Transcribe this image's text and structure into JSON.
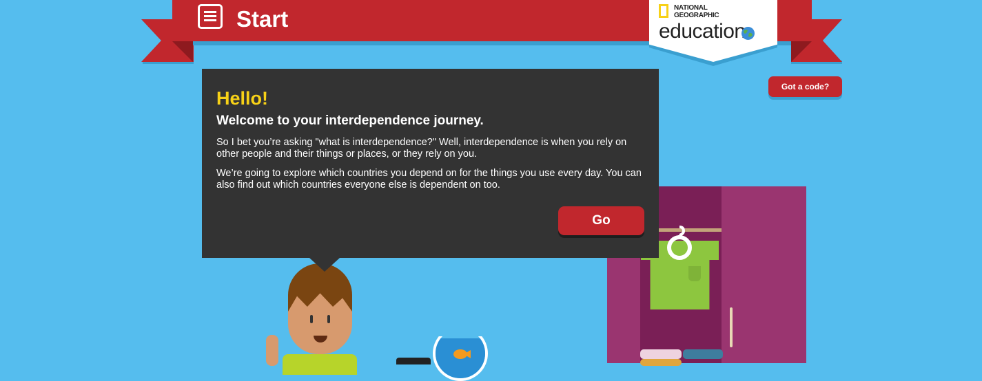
{
  "header": {
    "title": "Start"
  },
  "logo": {
    "brand": "NATIONAL GEOGRAPHIC",
    "product": "education"
  },
  "code_button": {
    "label": "Got a code?"
  },
  "dialog": {
    "greeting": "Hello!",
    "heading": "Welcome to your interdependence journey.",
    "paragraphs": [
      "So I bet you’re asking \"what is interdependence?\" Well, interdependence is when you rely on other people and their things or places, or they rely on you.",
      "We’re going to explore which countries you depend on for the things you use every day. You can also find out which countries everyone else is dependent on too."
    ],
    "go_label": "Go"
  },
  "colors": {
    "background": "#55bdee",
    "ribbon": "#c1272d",
    "dialog": "#333333",
    "greeting": "#f7d117"
  }
}
